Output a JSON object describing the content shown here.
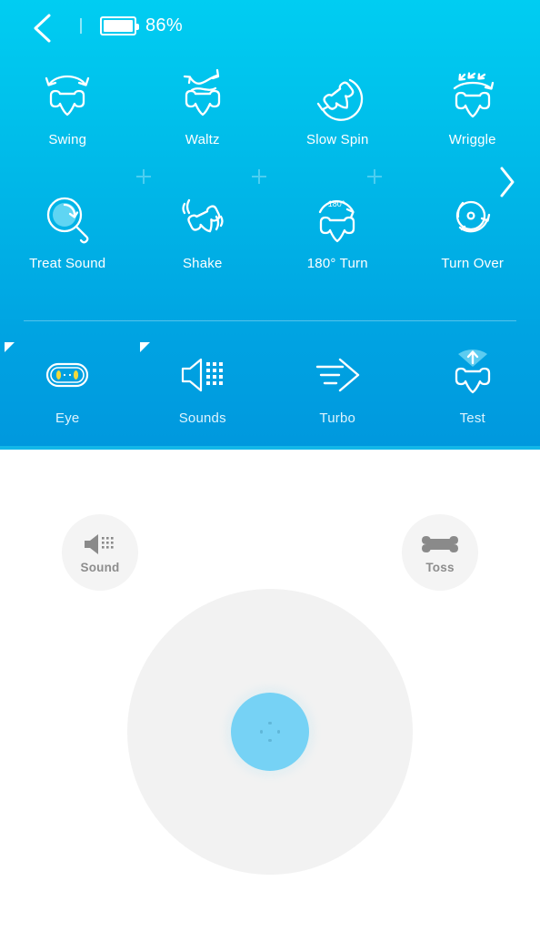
{
  "header": {
    "back_icon": "chevron-left-icon",
    "divider": "|",
    "battery_icon": "battery-icon",
    "battery_percent_label": "86%",
    "battery_level": 86
  },
  "colors": {
    "gradient_top": "#00CDF2",
    "gradient_bottom": "#0098DE",
    "panel_edge": "#12B7E8",
    "label_white": "#FFFFFF",
    "label_pale": "#DDF4FD",
    "joystick_base": "#F2F2F2",
    "joystick_knob": "#76D2F5",
    "round_button_bg": "#F4F4F4",
    "round_button_label": "#8D8D8D",
    "eye_color": "#F0D93C"
  },
  "actions": {
    "row1": [
      {
        "label": "Swing",
        "icon": "bone-swing-icon"
      },
      {
        "label": "Waltz",
        "icon": "bone-waltz-icon"
      },
      {
        "label": "Slow Spin",
        "icon": "bone-slow-spin-icon"
      },
      {
        "label": "Wriggle",
        "icon": "bone-wriggle-icon"
      }
    ],
    "row2": [
      {
        "label": "Treat Sound",
        "icon": "treat-sound-icon"
      },
      {
        "label": "Shake",
        "icon": "bone-shake-icon"
      },
      {
        "label": "180° Turn",
        "icon": "bone-180-turn-icon",
        "arc_label": "180°"
      },
      {
        "label": "Turn Over",
        "icon": "bone-turn-over-icon"
      }
    ],
    "row3": [
      {
        "label": "Eye",
        "icon": "eye-icon",
        "flag": true
      },
      {
        "label": "Sounds",
        "icon": "speaker-icon",
        "flag": true
      },
      {
        "label": "Turbo",
        "icon": "turbo-icon",
        "flag": false
      },
      {
        "label": "Test",
        "icon": "bone-test-signal-icon",
        "flag": false
      }
    ]
  },
  "pagination": {
    "separators": [
      "plus-icon",
      "plus-icon",
      "plus-icon"
    ],
    "next_icon": "chevron-right-icon"
  },
  "controls": {
    "sound_button": {
      "label": "Sound",
      "icon": "speaker-icon"
    },
    "toss_button": {
      "label": "Toss",
      "icon": "bone-icon"
    },
    "joystick": {
      "base": "joystick-base",
      "knob": "joystick-knob",
      "knob_dots": 4
    }
  }
}
